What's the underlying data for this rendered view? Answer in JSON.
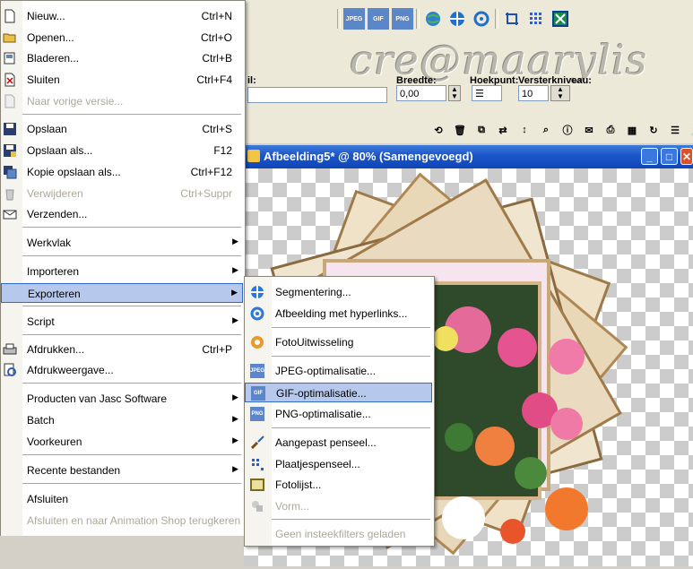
{
  "watermark": "cre@maarylis",
  "toolbar": {
    "icons_top": [
      "jpeg-icon",
      "gif-icon",
      "png-icon",
      "globe-icon",
      "target-icon",
      "hotspot-icon",
      "crop-icon",
      "grid-icon",
      "map-icon"
    ],
    "icon_text": {
      "jpeg": "JPEG",
      "gif": "GIF",
      "png": "PNG"
    },
    "partial_label": "il:",
    "width_label": "Breedte:",
    "width_value": "0,00",
    "corner_label": "Hoekpunt:",
    "corner_value": "☰",
    "strength_label": "Versterkniveau:",
    "strength_value": "10"
  },
  "document": {
    "title": "Afbeelding5* @  80% (Samengevoegd)",
    "min": "_",
    "max": "□",
    "close": "✕"
  },
  "main_menu": {
    "items": [
      {
        "label": "Nieuw...",
        "shortcut": "Ctrl+N",
        "icon": "new-file-icon"
      },
      {
        "label": "Openen...",
        "shortcut": "Ctrl+O",
        "icon": "open-folder-icon"
      },
      {
        "label": "Bladeren...",
        "shortcut": "Ctrl+B",
        "icon": "browse-icon"
      },
      {
        "label": "Sluiten",
        "shortcut": "Ctrl+F4",
        "icon": "close-file-icon"
      },
      {
        "label": "Naar vorige versie...",
        "shortcut": "",
        "icon": "revert-icon",
        "disabled": true
      },
      {
        "label": "Opslaan",
        "shortcut": "Ctrl+S",
        "icon": "save-icon"
      },
      {
        "label": "Opslaan als...",
        "shortcut": "F12",
        "icon": "save-as-icon"
      },
      {
        "label": "Kopie opslaan als...",
        "shortcut": "Ctrl+F12",
        "icon": "save-copy-icon"
      },
      {
        "label": "Verwijderen",
        "shortcut": "Ctrl+Suppr",
        "icon": "delete-icon",
        "disabled": true
      },
      {
        "label": "Verzenden...",
        "shortcut": "",
        "icon": "send-icon"
      },
      {
        "label": "Werkvlak",
        "submenu": true
      },
      {
        "label": "Importeren",
        "submenu": true
      },
      {
        "label": "Exporteren",
        "submenu": true,
        "highlight": true
      },
      {
        "label": "Script",
        "submenu": true
      },
      {
        "label": "Afdrukken...",
        "shortcut": "Ctrl+P",
        "icon": "print-icon"
      },
      {
        "label": "Afdrukweergave...",
        "shortcut": "",
        "icon": "print-preview-icon"
      },
      {
        "label": "Producten van Jasc Software",
        "submenu": true
      },
      {
        "label": "Batch",
        "submenu": true
      },
      {
        "label": "Voorkeuren",
        "submenu": true
      },
      {
        "label": "Recente bestanden",
        "submenu": true
      },
      {
        "label": "Afsluiten",
        "shortcut": ""
      },
      {
        "label": "Afsluiten en naar Animation Shop terugkeren",
        "shortcut": "",
        "disabled": true
      }
    ]
  },
  "export_menu": {
    "items": [
      {
        "label": "Segmentering...",
        "icon": "slice-icon"
      },
      {
        "label": "Afbeelding met hyperlinks...",
        "icon": "image-map-icon"
      },
      {
        "label": "FotoUitwisseling",
        "icon": "photo-exchange-icon"
      },
      {
        "label": "JPEG-optimalisatie...",
        "icon": "jpeg-icon",
        "badge": "JPEG"
      },
      {
        "label": "GIF-optimalisatie...",
        "icon": "gif-icon",
        "badge": "GIF",
        "highlight": true
      },
      {
        "label": "PNG-optimalisatie...",
        "icon": "png-icon",
        "badge": "PNG"
      },
      {
        "label": "Aangepast penseel...",
        "icon": "brush-icon"
      },
      {
        "label": "Plaatjespenseel...",
        "icon": "picture-tube-icon"
      },
      {
        "label": "Fotolijst...",
        "icon": "frame-icon"
      },
      {
        "label": "Vorm...",
        "icon": "shape-icon",
        "disabled": true
      },
      {
        "label": "Geen insteekfilters geladen",
        "disabled": true
      }
    ]
  },
  "colors": {
    "highlight": "#b6c8ec",
    "highlight_border": "#3169c6",
    "title_bar": "#1a55c9",
    "arrow": "#2a4fd0"
  }
}
